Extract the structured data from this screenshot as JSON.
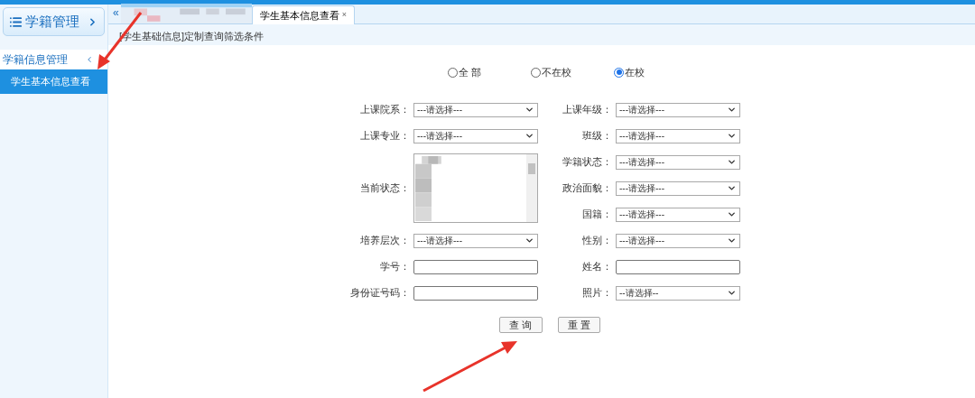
{
  "sidebar": {
    "header": {
      "label": "学籍管理"
    },
    "groups": [
      {
        "label": "学籍信息管理",
        "expanded": true,
        "items": [
          {
            "label": "学生基本信息查看",
            "selected": true
          }
        ]
      }
    ]
  },
  "tab_bar": {
    "collapse_glyph": "«",
    "tabs": [
      {
        "label": "学生基本信息查看",
        "selected": true,
        "close": "×"
      }
    ]
  },
  "panel": {
    "title": "[学生基础信息]定制查询筛选条件",
    "radios": [
      {
        "label": "全 部",
        "selected": false
      },
      {
        "label": "不在校",
        "selected": false
      },
      {
        "label": "在校",
        "selected": true
      }
    ],
    "left_fields": [
      {
        "label": "上课院系：",
        "kind": "select",
        "value": "---请选择---"
      },
      {
        "label": "上课专业：",
        "kind": "select",
        "value": "---请选择---"
      },
      {
        "label": "当前状态：",
        "kind": "listbox"
      },
      {
        "label": "培养层次：",
        "kind": "select",
        "value": "---请选择---"
      },
      {
        "label": "学号：",
        "kind": "text"
      },
      {
        "label": "身份证号码：",
        "kind": "text"
      }
    ],
    "right_fields": [
      {
        "label": "上课年级：",
        "kind": "select",
        "value": "---请选择---"
      },
      {
        "label": "班级：",
        "kind": "select",
        "value": "---请选择---"
      },
      {
        "label": "学籍状态：",
        "kind": "select",
        "value": "---请选择---"
      },
      {
        "label": "政治面貌：",
        "kind": "select",
        "value": "---请选择---"
      },
      {
        "label": "国籍：",
        "kind": "select",
        "value": "---请选择---"
      },
      {
        "label": "性别：",
        "kind": "select",
        "value": "---请选择---"
      },
      {
        "label": "姓名：",
        "kind": "text"
      },
      {
        "label": "照片：",
        "kind": "select",
        "value": "--请选择--"
      }
    ],
    "buttons": [
      "查 询",
      "重 置"
    ]
  }
}
